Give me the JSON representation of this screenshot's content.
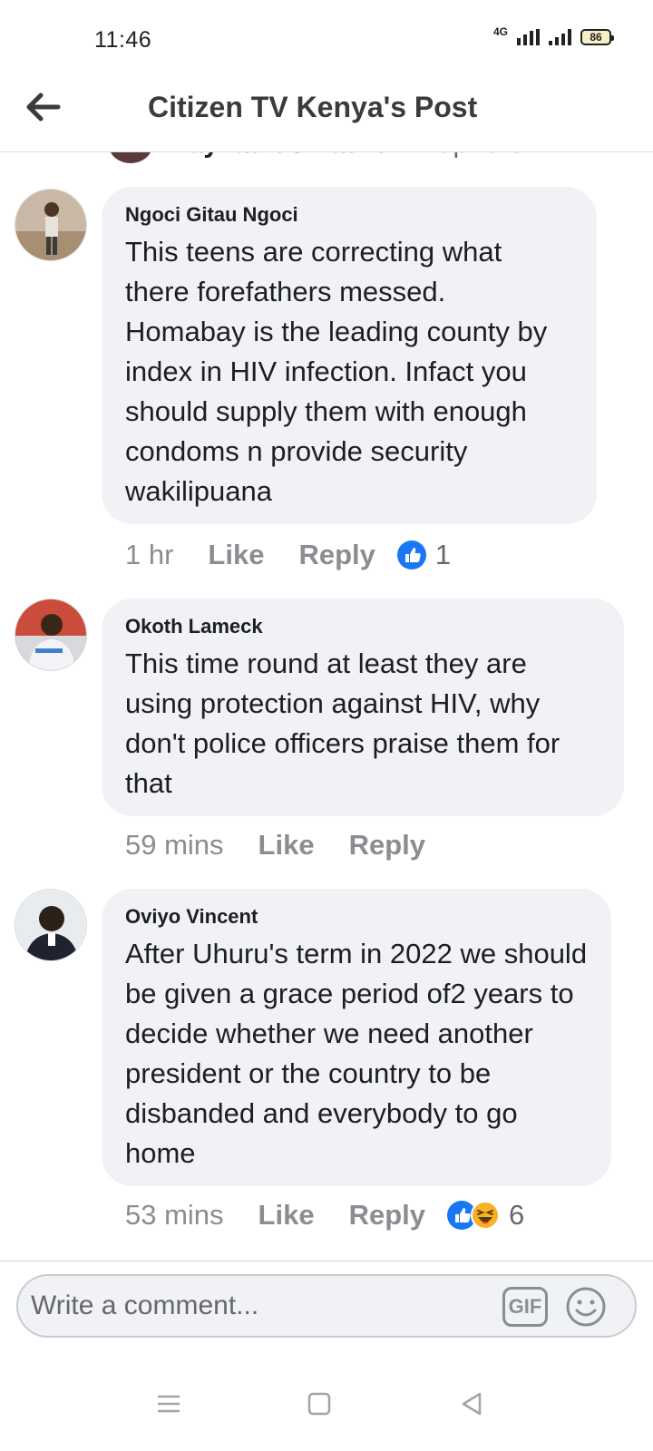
{
  "status_bar": {
    "time": "11:46",
    "network": "4G",
    "battery": "86"
  },
  "header": {
    "title": "Citizen TV Kenya's Post"
  },
  "partial_comment": {
    "name": "Nayvadius Patrick",
    "extra": "ArapKarun ..."
  },
  "comments": [
    {
      "author": "Ngoci Gitau Ngoci",
      "text": "This teens are correcting what there forefathers messed. Homabay is the leading county by index in HIV infection. Infact you should supply them with enough condoms n provide security wakilipuana",
      "time": "1 hr",
      "like_label": "Like",
      "reply_label": "Reply",
      "reactions": [
        "like"
      ],
      "reaction_count": "1"
    },
    {
      "author": "Okoth Lameck",
      "text": "This time round at least they are using protection against HIV, why don't police officers praise them for that",
      "time": "59 mins",
      "like_label": "Like",
      "reply_label": "Reply",
      "reactions": [],
      "reaction_count": ""
    },
    {
      "author": "Oviyo Vincent",
      "text": "After Uhuru's term in 2022  we should be given a grace period of2 years to decide whether we need another president or the country to be disbanded and everybody to go home",
      "time": "53 mins",
      "like_label": "Like",
      "reply_label": "Reply",
      "reactions": [
        "like",
        "haha"
      ],
      "reaction_count": "6"
    }
  ],
  "composer": {
    "placeholder": "Write a comment...",
    "gif_label": "GIF"
  },
  "colors": {
    "bubble": "#f0f2f5",
    "like_blue": "#1877f2",
    "haha_yellow": "#f7b125",
    "muted_text": "#8a8d91"
  }
}
